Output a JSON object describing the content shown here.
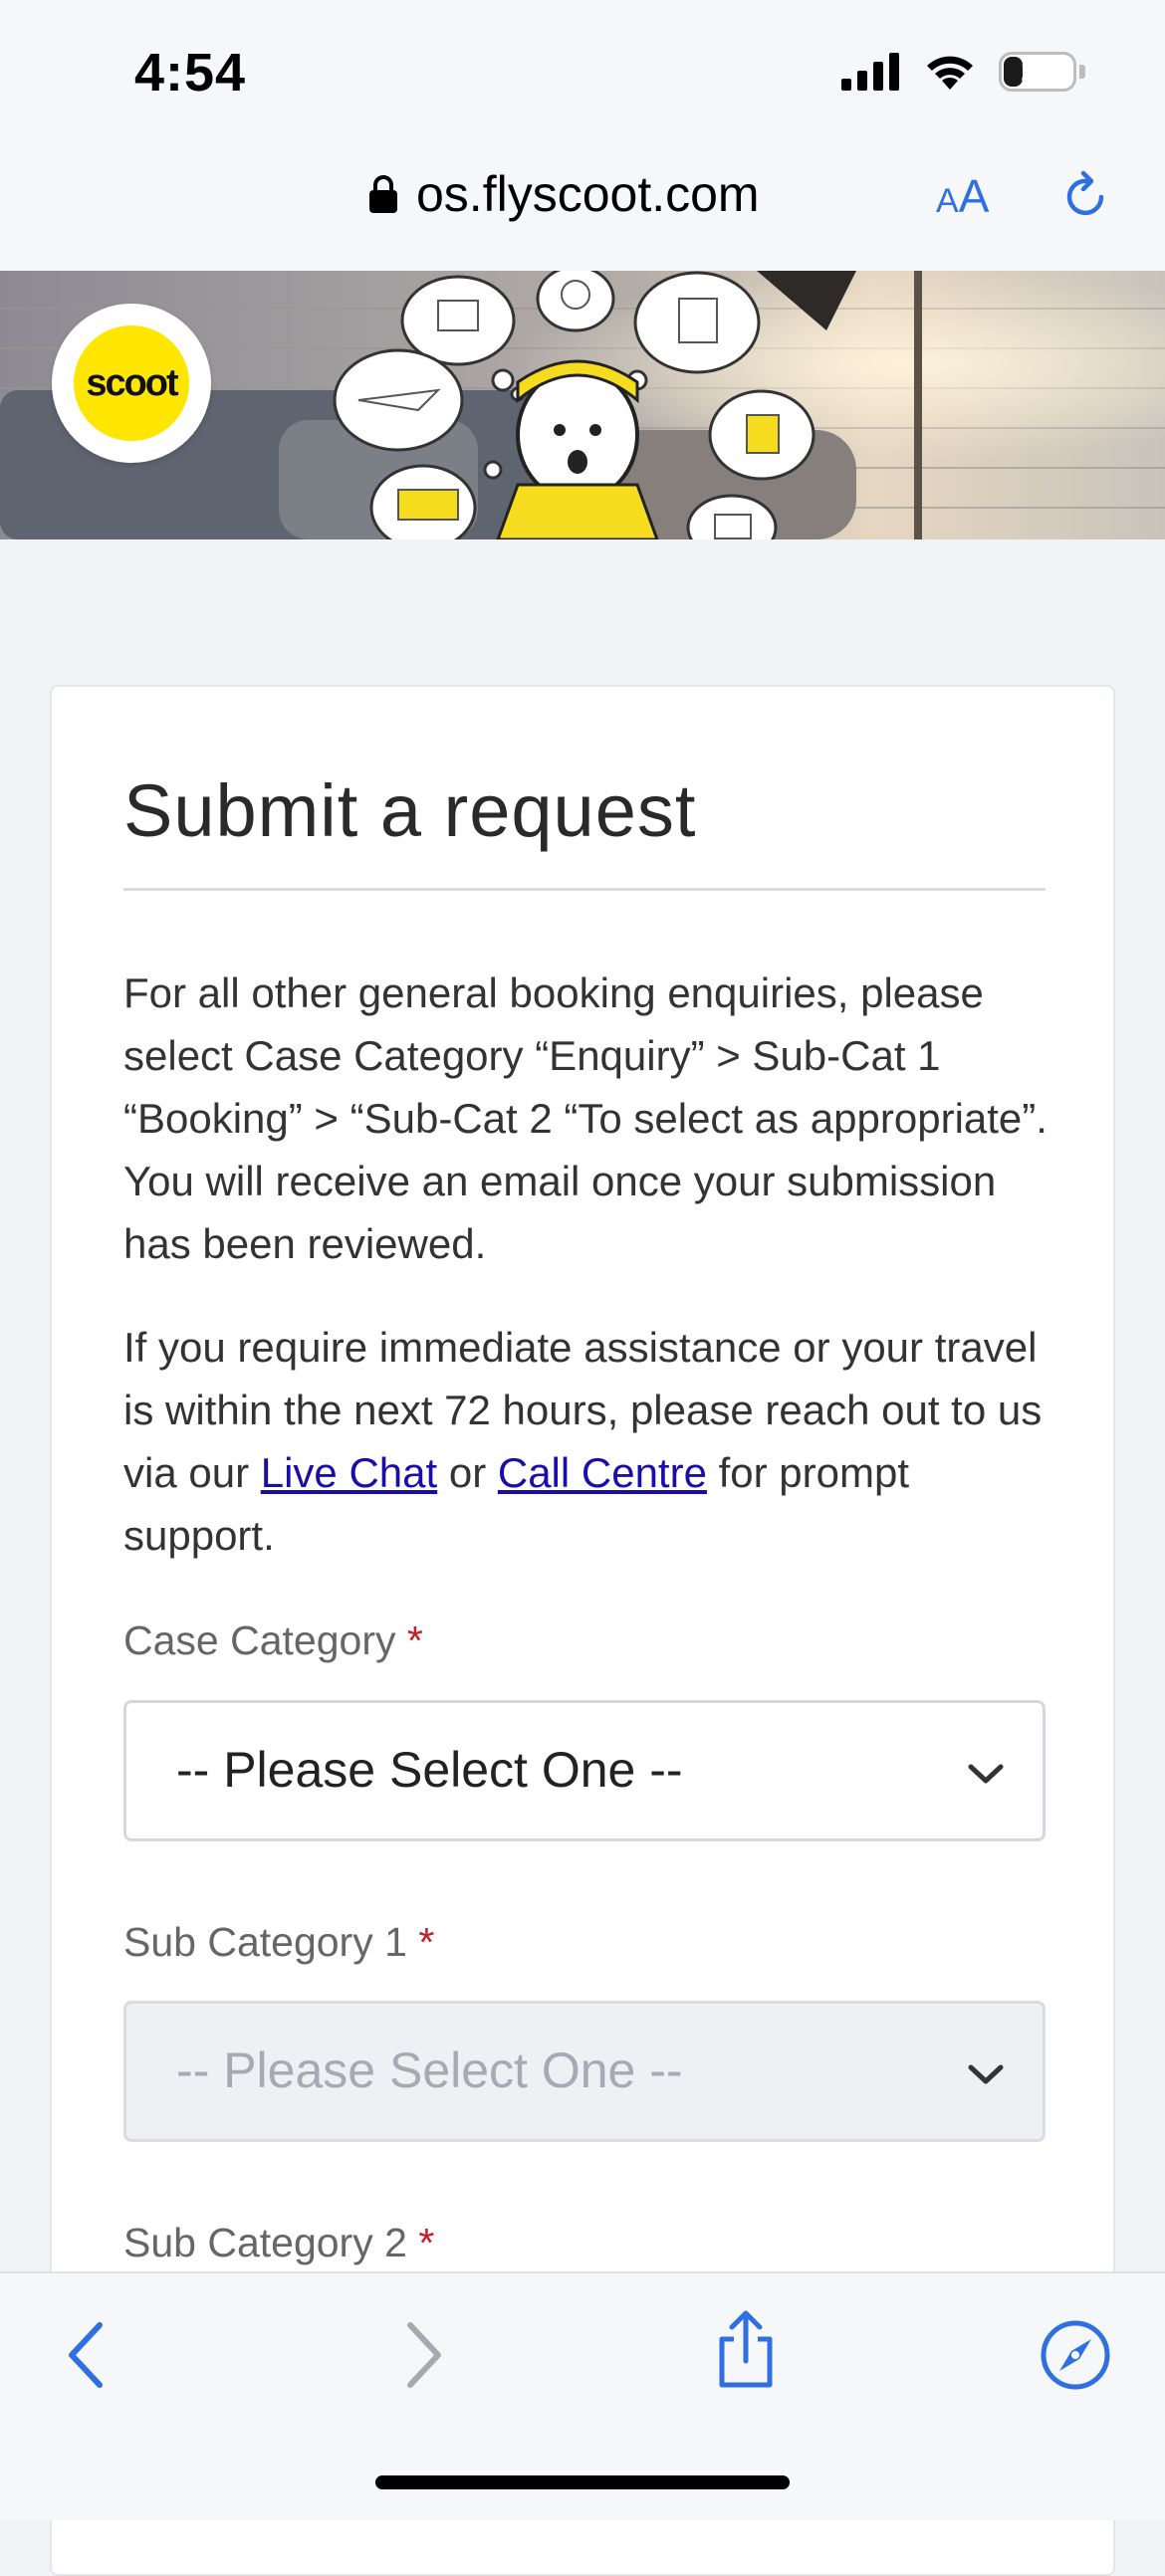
{
  "status_bar": {
    "time": "4:54",
    "battery_level": "27"
  },
  "address_bar": {
    "url": "os.flyscoot.com",
    "text_size_label_small": "A",
    "text_size_label_large": "A"
  },
  "banner": {
    "logo_text": "scoot",
    "brand_color": "#ffe600"
  },
  "form": {
    "title": "Submit a request",
    "intro_paragraph": "For all other general booking enquiries, please select Case Category “Enquiry” > Sub-Cat 1 “Booking” > “Sub-Cat 2 “To select as appropriate”. You will receive an email once your submission has been reviewed.",
    "assist_text_1": "If you require immediate assistance or your travel is within the next 72 hours, please reach out to us via our ",
    "live_chat_link": "Live Chat",
    "assist_text_2": " or ",
    "call_centre_link": "Call Centre",
    "assist_text_3": " for prompt support.",
    "required_marker": "*",
    "case_category": {
      "label": "Case Category",
      "value": "-- Please Select One --"
    },
    "sub_category_1": {
      "label": "Sub Category 1",
      "value": "-- Please Select One --"
    },
    "sub_category_2": {
      "label": "Sub Category 2"
    }
  },
  "colors": {
    "accent_blue": "#2f6fe0",
    "link_blue": "#1a0dab",
    "required_red": "#c0202a"
  }
}
